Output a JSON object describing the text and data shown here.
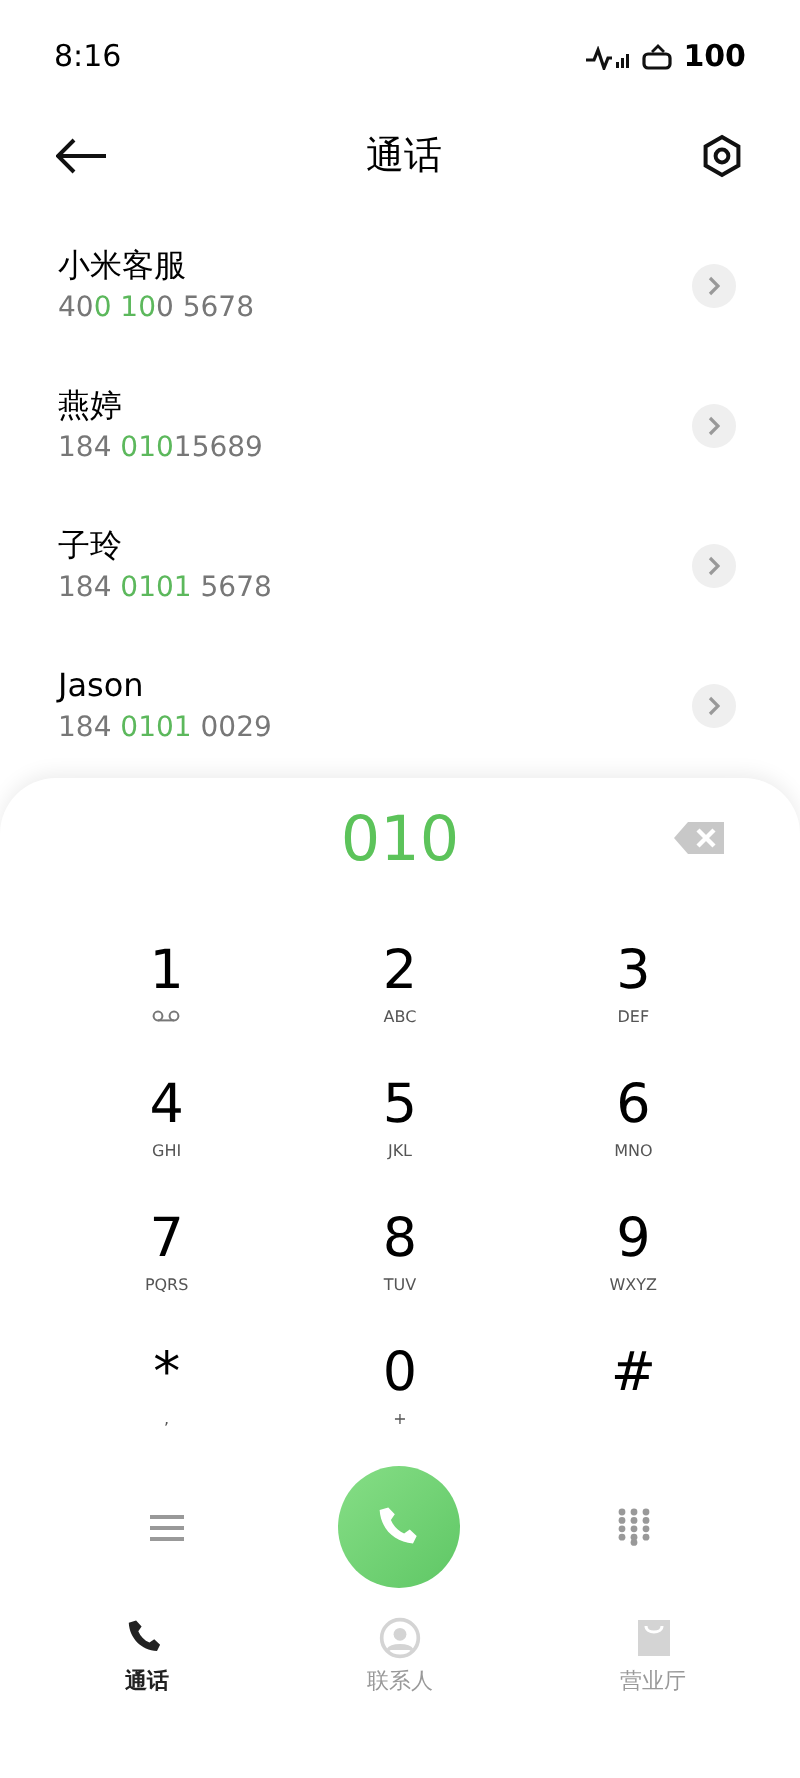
{
  "status_bar": {
    "time": "8:16",
    "battery": "100"
  },
  "header": {
    "title": "通话"
  },
  "contacts": [
    {
      "name": "小米客服",
      "number": [
        {
          "text": "40",
          "match": false
        },
        {
          "text": "0 10",
          "match": true
        },
        {
          "text": "0 5678",
          "match": false
        }
      ]
    },
    {
      "name": "燕婷",
      "number": [
        {
          "text": "184 ",
          "match": false
        },
        {
          "text": "010",
          "match": true
        },
        {
          "text": "15689",
          "match": false
        }
      ]
    },
    {
      "name": "子玲",
      "number": [
        {
          "text": "184 ",
          "match": false
        },
        {
          "text": "0101",
          "match": true
        },
        {
          "text": " 5678",
          "match": false
        }
      ]
    },
    {
      "name": "Jason",
      "number": [
        {
          "text": "184 ",
          "match": false
        },
        {
          "text": "0101",
          "match": true
        },
        {
          "text": " 0029",
          "match": false
        }
      ]
    }
  ],
  "dialer": {
    "input": "010"
  },
  "keys": [
    {
      "kind": "voicemail",
      "digit": "1"
    },
    {
      "kind": "letters",
      "digit": "2",
      "letters": "ABC"
    },
    {
      "kind": "letters",
      "digit": "3",
      "letters": "DEF"
    },
    {
      "kind": "letters",
      "digit": "4",
      "letters": "GHI"
    },
    {
      "kind": "letters",
      "digit": "5",
      "letters": "JKL"
    },
    {
      "kind": "letters",
      "digit": "6",
      "letters": "MNO"
    },
    {
      "kind": "letters",
      "digit": "7",
      "letters": "PQRS"
    },
    {
      "kind": "letters",
      "digit": "8",
      "letters": "TUV"
    },
    {
      "kind": "letters",
      "digit": "9",
      "letters": "WXYZ"
    },
    {
      "kind": "letters",
      "digit": "*",
      "letters": ","
    },
    {
      "kind": "letters",
      "digit": "0",
      "letters": "+"
    },
    {
      "kind": "symbol",
      "digit": "#"
    }
  ],
  "tabs": [
    {
      "kind": "calls",
      "label": "通话",
      "selected": true
    },
    {
      "kind": "contacts",
      "label": "联系人",
      "selected": false
    },
    {
      "kind": "store",
      "label": "营业厅",
      "selected": false
    }
  ]
}
